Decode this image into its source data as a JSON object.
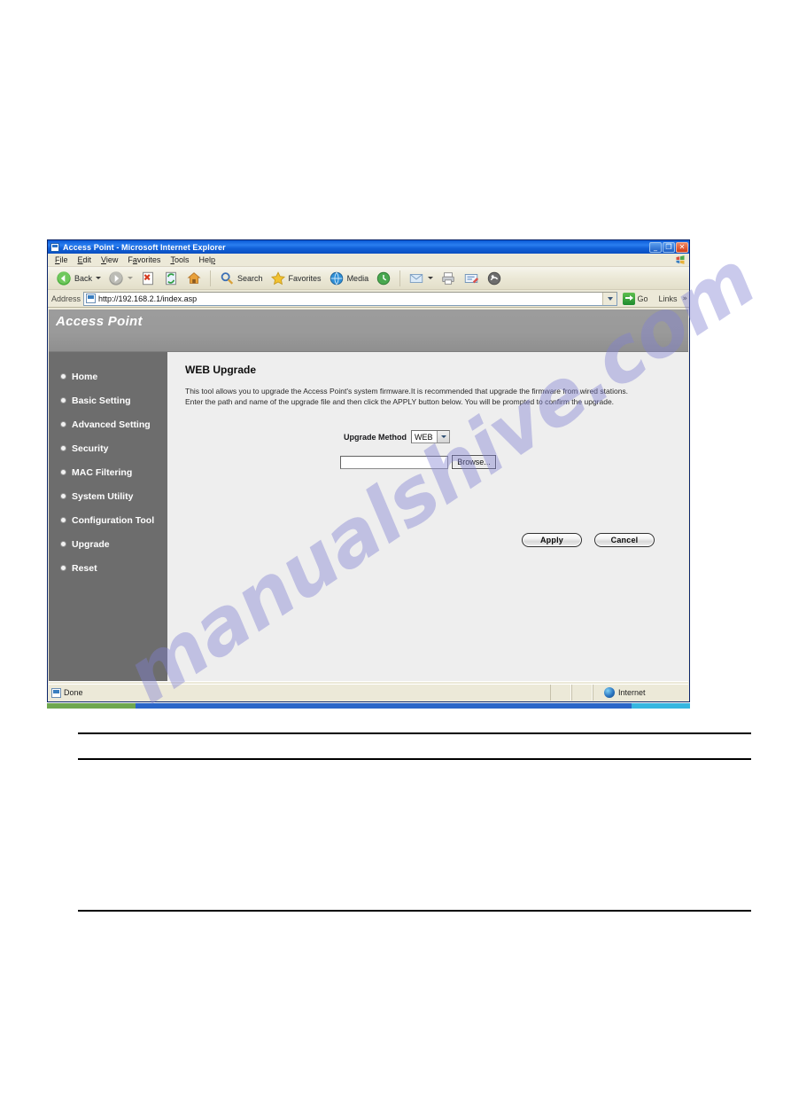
{
  "browser": {
    "title": "Access Point - Microsoft Internet Explorer",
    "window_buttons": {
      "minimize": "_",
      "restore": "❐",
      "close": "✕"
    },
    "menu": [
      {
        "label": "File",
        "accel": "F"
      },
      {
        "label": "Edit",
        "accel": "E"
      },
      {
        "label": "View",
        "accel": "V"
      },
      {
        "label": "Favorites",
        "accel": "a"
      },
      {
        "label": "Tools",
        "accel": "T"
      },
      {
        "label": "Help",
        "accel": "H"
      }
    ],
    "toolbar": {
      "back": "Back",
      "forward": "",
      "stop": "",
      "refresh": "",
      "home": "",
      "search": "Search",
      "favorites": "Favorites",
      "media": "Media",
      "history": "",
      "mail": "",
      "print": "",
      "edit": "",
      "messenger": ""
    },
    "address": {
      "label": "Address",
      "url": "http://192.168.2.1/index.asp",
      "go": "Go",
      "links": "Links",
      "chevron": "»"
    },
    "status": {
      "text": "Done",
      "zone": "Internet"
    }
  },
  "page": {
    "banner_title": "Access Point",
    "sidebar": [
      {
        "label": "Home"
      },
      {
        "label": "Basic Setting"
      },
      {
        "label": "Advanced Setting"
      },
      {
        "label": "Security"
      },
      {
        "label": "MAC Filtering"
      },
      {
        "label": "System Utility"
      },
      {
        "label": "Configuration Tool"
      },
      {
        "label": "Upgrade"
      },
      {
        "label": "Reset"
      }
    ],
    "content": {
      "title": "WEB Upgrade",
      "description_line1": "This tool allows you to upgrade the Access Point's system firmware.It is recommended that upgrade the firmware from wired stations.",
      "description_line2": "Enter the path and name of the upgrade file and then click the APPLY button below. You will be prompted to confirm the upgrade.",
      "upgrade_method_label": "Upgrade Method",
      "upgrade_method_value": "WEB",
      "file_input_value": "",
      "browse_label": "Browse...",
      "apply_label": "Apply",
      "cancel_label": "Cancel"
    }
  },
  "watermark": {
    "text": "manualshive.com"
  },
  "colors": {
    "titlebar_blue": "#0a5ad6",
    "banner_grey": "#9c9c9c",
    "sidebar_grey": "#6d6d6d",
    "content_grey": "#eeeeee",
    "chrome_beige": "#ece9d8"
  }
}
